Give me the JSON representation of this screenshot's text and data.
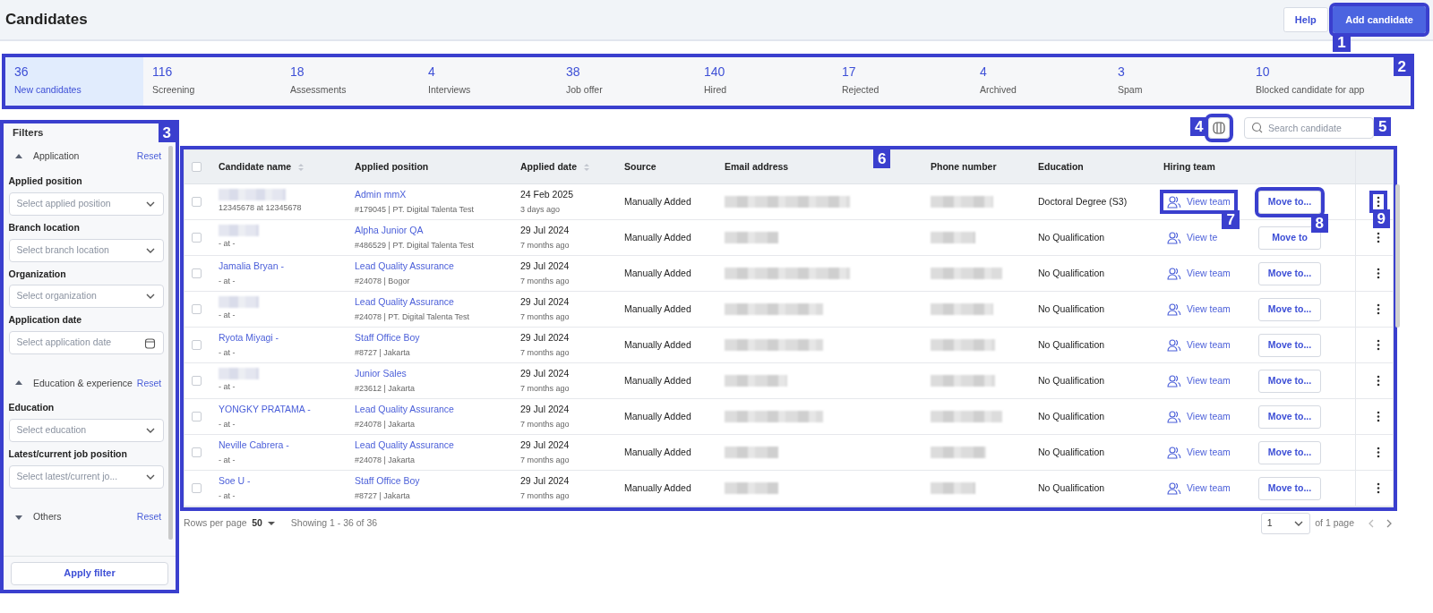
{
  "header": {
    "title": "Candidates",
    "help_button": "Help",
    "add_button": {
      "label": "Add candidate",
      "callout": "1"
    }
  },
  "stages": {
    "callout": "2",
    "items": [
      {
        "count": "36",
        "label": "New candidates",
        "selected": true
      },
      {
        "count": "116",
        "label": "Screening",
        "selected": false
      },
      {
        "count": "18",
        "label": "Assessments",
        "selected": false
      },
      {
        "count": "4",
        "label": "Interviews",
        "selected": false
      },
      {
        "count": "38",
        "label": "Job offer",
        "selected": false
      },
      {
        "count": "140",
        "label": "Hired",
        "selected": false
      },
      {
        "count": "17",
        "label": "Rejected",
        "selected": false
      },
      {
        "count": "4",
        "label": "Archived",
        "selected": false
      },
      {
        "count": "3",
        "label": "Spam",
        "selected": false
      },
      {
        "count": "10",
        "label": "Blocked candidate for app",
        "selected": false
      }
    ]
  },
  "filters": {
    "title": "Filters",
    "callout": "3",
    "apply_button": "Apply filter",
    "sections": [
      {
        "title": "Application",
        "reset": "Reset",
        "expanded": true,
        "fields": [
          {
            "label": "Applied position",
            "placeholder": "Select applied position",
            "kind": "select"
          },
          {
            "label": "Branch location",
            "placeholder": "Select branch location",
            "kind": "select"
          },
          {
            "label": "Organization",
            "placeholder": "Select organization",
            "kind": "select"
          },
          {
            "label": "Application date",
            "placeholder": "Select application date",
            "kind": "date"
          }
        ]
      },
      {
        "title": "Education & experience",
        "reset": "Reset",
        "expanded": true,
        "fields": [
          {
            "label": "Education",
            "placeholder": "Select education",
            "kind": "select"
          },
          {
            "label": "Latest/current job position",
            "placeholder": "Select latest/current jo...",
            "kind": "select"
          }
        ]
      },
      {
        "title": "Others",
        "reset": "Reset",
        "expanded": false
      }
    ]
  },
  "toolbar": {
    "columns_callout": "4",
    "search": {
      "placeholder": "Search candidate",
      "callout": "5"
    }
  },
  "table": {
    "callout": "6",
    "select_all_checked": false,
    "columns": [
      {
        "label": "Candidate name",
        "sortable": true
      },
      {
        "label": "Applied position",
        "sortable": false
      },
      {
        "label": "Applied date",
        "sortable": true
      },
      {
        "label": "Source",
        "sortable": false
      },
      {
        "label": "Email address",
        "sortable": false
      },
      {
        "label": "Phone number",
        "sortable": false
      },
      {
        "label": "Education",
        "sortable": false
      },
      {
        "label": "Hiring team",
        "sortable": false
      }
    ],
    "rows": [
      {
        "checked": false,
        "name_redacted": true,
        "name_sub": "12345678 at 12345678",
        "position": "Admin mmX",
        "position_sub": "#179045 | PT. Digital Talenta Test",
        "date": "24 Feb 2025",
        "ago": "3 days ago",
        "source": "Manually Added",
        "email_redacted": true,
        "phone_redacted": true,
        "education": "Doctoral Degree (S3)",
        "team": {
          "label": "View team",
          "callout": "7"
        },
        "move": {
          "label": "Move to...",
          "callout": "8"
        },
        "menu_callout": "9"
      },
      {
        "checked": false,
        "name_redacted": true,
        "name_sub": "- at -",
        "position": "Alpha Junior QA",
        "position_sub": "#486529 | PT. Digital Talenta Test",
        "date": "29 Jul 2024",
        "ago": "7 months ago",
        "source": "Manually Added",
        "email_redacted": true,
        "phone_redacted": true,
        "education": "No Qualification",
        "team": {
          "label": "View te"
        },
        "move": {
          "label": "Move to"
        }
      },
      {
        "checked": false,
        "name": "Jamalia Bryan -",
        "name_sub": "- at -",
        "position": "Lead Quality Assurance",
        "position_sub": "#24078 | Bogor",
        "date": "29 Jul 2024",
        "ago": "7 months ago",
        "source": "Manually Added",
        "email_redacted": true,
        "phone_redacted": true,
        "education": "No Qualification",
        "team": {
          "label": "View team"
        },
        "move": {
          "label": "Move to..."
        }
      },
      {
        "checked": false,
        "name_redacted": true,
        "name_sub": "- at -",
        "position": "Lead Quality Assurance",
        "position_sub": "#24078 | PT. Digital Talenta Test",
        "date": "29 Jul 2024",
        "ago": "7 months ago",
        "source": "Manually Added",
        "email_redacted": true,
        "phone_redacted": true,
        "education": "No Qualification",
        "team": {
          "label": "View team"
        },
        "move": {
          "label": "Move to..."
        }
      },
      {
        "checked": false,
        "name": "Ryota Miyagi -",
        "name_sub": "- at -",
        "position": "Staff Office Boy",
        "position_sub": "#8727 | Jakarta",
        "date": "29 Jul 2024",
        "ago": "7 months ago",
        "source": "Manually Added",
        "email_redacted": true,
        "phone_redacted": true,
        "education": "No Qualification",
        "team": {
          "label": "View team"
        },
        "move": {
          "label": "Move to..."
        }
      },
      {
        "checked": false,
        "name_redacted": true,
        "name_sub": "- at -",
        "position": "Junior Sales",
        "position_sub": "#23612 | Jakarta",
        "date": "29 Jul 2024",
        "ago": "7 months ago",
        "source": "Manually Added",
        "email_redacted": true,
        "phone_redacted": true,
        "education": "No Qualification",
        "team": {
          "label": "View team"
        },
        "move": {
          "label": "Move to..."
        }
      },
      {
        "checked": false,
        "name": "YONGKY PRATAMA -",
        "name_sub": "- at -",
        "position": "Lead Quality Assurance",
        "position_sub": "#24078 | Jakarta",
        "date": "29 Jul 2024",
        "ago": "7 months ago",
        "source": "Manually Added",
        "email_redacted": true,
        "phone_redacted": true,
        "education": "No Qualification",
        "team": {
          "label": "View team"
        },
        "move": {
          "label": "Move to..."
        }
      },
      {
        "checked": false,
        "name": "Neville Cabrera -",
        "name_sub": "- at -",
        "position": "Lead Quality Assurance",
        "position_sub": "#24078 | Jakarta",
        "date": "29 Jul 2024",
        "ago": "7 months ago",
        "source": "Manually Added",
        "email_redacted": true,
        "phone_redacted": true,
        "education": "No Qualification",
        "team": {
          "label": "View team"
        },
        "move": {
          "label": "Move to..."
        }
      },
      {
        "checked": false,
        "name": "Soe U -",
        "name_sub": "- at -",
        "position": "Staff Office Boy",
        "position_sub": "#8727 | Jakarta",
        "date": "29 Jul 2024",
        "ago": "7 months ago",
        "source": "Manually Added",
        "email_redacted": true,
        "phone_redacted": true,
        "education": "No Qualification",
        "team": {
          "label": "View team"
        },
        "move": {
          "label": "Move to..."
        }
      }
    ]
  },
  "pagination": {
    "rows_label": "Rows per page",
    "rows_value": "50",
    "showing": "Showing 1 - 36 of 36",
    "page_value": "1",
    "page_total": "of 1 page"
  }
}
